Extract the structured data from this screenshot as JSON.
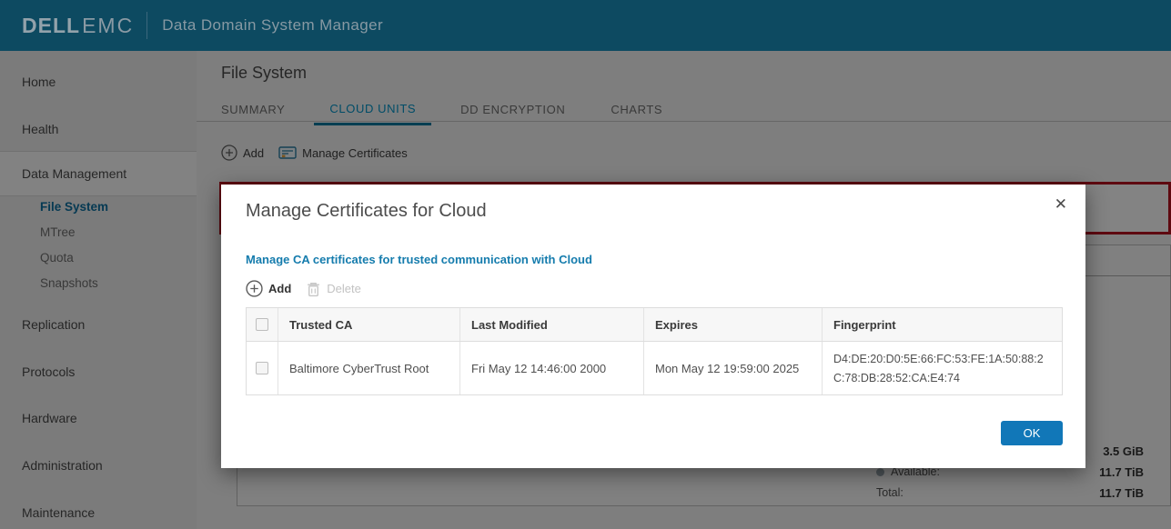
{
  "header": {
    "brand_primary": "DELL",
    "brand_secondary": "EMC",
    "app_title": "Data Domain System Manager"
  },
  "sidebar": {
    "items": [
      {
        "label": "Home"
      },
      {
        "label": "Health"
      },
      {
        "label": "Data Management",
        "active_section": true
      },
      {
        "label": "File System",
        "selected": true
      },
      {
        "label": "MTree"
      },
      {
        "label": "Quota"
      },
      {
        "label": "Snapshots"
      },
      {
        "label": "Replication"
      },
      {
        "label": "Protocols"
      },
      {
        "label": "Hardware"
      },
      {
        "label": "Administration"
      },
      {
        "label": "Maintenance"
      }
    ]
  },
  "content": {
    "page_title": "File System",
    "tabs": [
      {
        "label": "SUMMARY",
        "active": false
      },
      {
        "label": "CLOUD UNITS",
        "active": true
      },
      {
        "label": "DD ENCRYPTION",
        "active": false
      },
      {
        "label": "CHARTS",
        "active": false
      }
    ],
    "toolbar": {
      "add_label": "Add",
      "manage_certificates_label": "Manage Certificates"
    },
    "stats": {
      "rows": [
        {
          "label": "",
          "value": "3.5 GiB"
        },
        {
          "label": "Available:",
          "value": "11.7 TiB",
          "bullet": true
        },
        {
          "label": "Total:",
          "value": "11.7 TiB"
        }
      ]
    }
  },
  "modal": {
    "title": "Manage Certificates for Cloud",
    "close_glyph": "✕",
    "subtitle": "Manage CA certificates for trusted communication with Cloud",
    "toolbar": {
      "add_label": "Add",
      "delete_label": "Delete"
    },
    "table": {
      "headers": [
        "Trusted CA",
        "Last Modified",
        "Expires",
        "Fingerprint"
      ],
      "rows": [
        {
          "trusted_ca": "Baltimore CyberTrust Root",
          "last_modified": "Fri May 12 14:46:00 2000",
          "expires": "Mon May 12 19:59:00 2025",
          "fingerprint": "D4:DE:20:D0:5E:66:FC:53:FE:1A:50:88:2C:78:DB:28:52:CA:E4:74"
        }
      ]
    },
    "ok_label": "OK"
  },
  "icons": {
    "add": "circle-plus",
    "manage_certificates": "certificate-card",
    "delete": "trash",
    "close": "x",
    "available_legend": "dot"
  },
  "colors": {
    "header_bg": "#0d4a61",
    "accent_blue": "#1177b8",
    "tab_active_blue": "#0093c6",
    "link_blue": "#157cad",
    "banner_red": "#b5121f"
  }
}
